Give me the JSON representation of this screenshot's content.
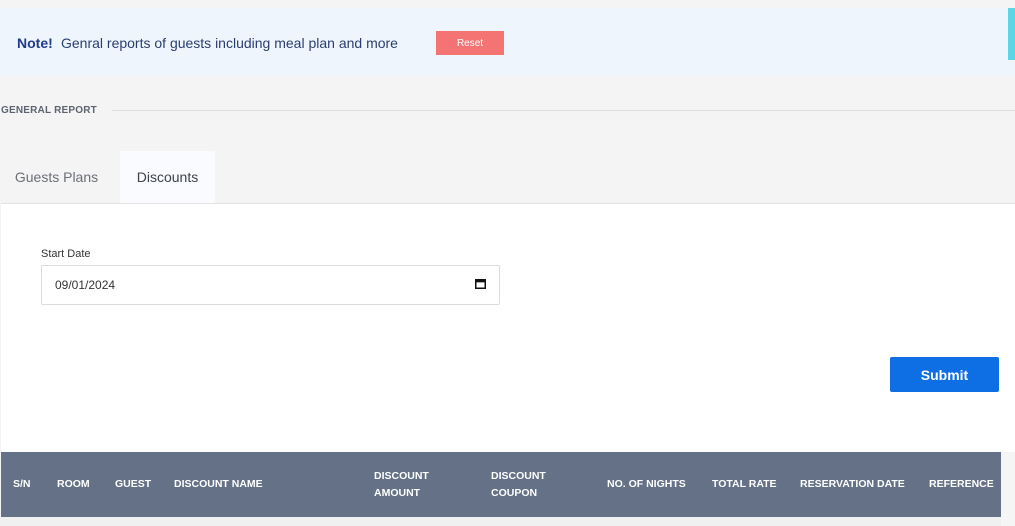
{
  "note": {
    "title": "Note!",
    "text": "Genral reports of guests including meal plan and more",
    "reset_label": "Reset"
  },
  "section": {
    "title": "GENERAL REPORT"
  },
  "tabs": [
    {
      "label": "Guests Plans",
      "active": false
    },
    {
      "label": "Discounts",
      "active": true
    }
  ],
  "form": {
    "start_date_label": "Start Date",
    "start_date_value": "09/01/2024",
    "submit_label": "Submit"
  },
  "table": {
    "headers": [
      {
        "line1": "S/N",
        "line2": ""
      },
      {
        "line1": "ROOM",
        "line2": ""
      },
      {
        "line1": "GUEST",
        "line2": ""
      },
      {
        "line1": "DISCOUNT NAME",
        "line2": ""
      },
      {
        "line1": "DISCOUNT",
        "line2": "AMOUNT"
      },
      {
        "line1": "DISCOUNT",
        "line2": "COUPON"
      },
      {
        "line1": "NO. OF NIGHTS",
        "line2": ""
      },
      {
        "line1": "TOTAL RATE",
        "line2": ""
      },
      {
        "line1": "RESERVATION DATE",
        "line2": ""
      },
      {
        "line1": "REFERENCE",
        "line2": ""
      }
    ]
  },
  "colors": {
    "accent": "#0e6fe5",
    "reset": "#f47474",
    "table_header": "#647187",
    "note_bg": "#eef5fd"
  }
}
